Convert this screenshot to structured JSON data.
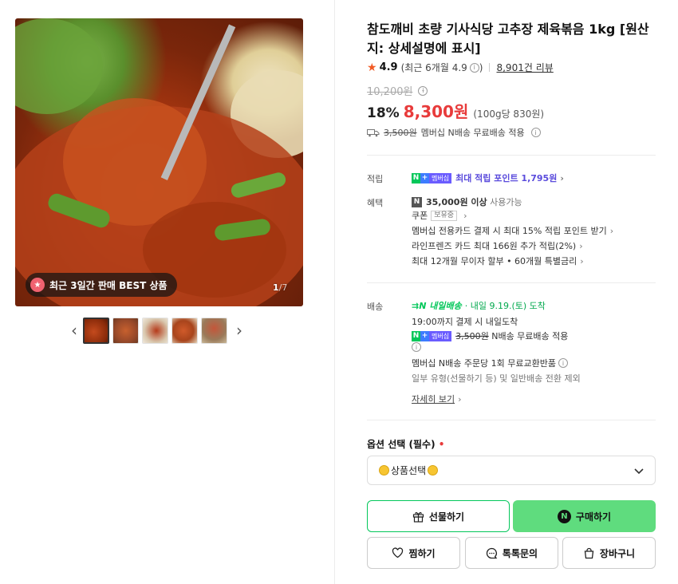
{
  "gallery": {
    "badge_text": "최근 3일간 판매 BEST 상품",
    "counter_current": "1",
    "counter_total": "/7",
    "thumbnail_count": 5
  },
  "product": {
    "title": "참도깨비 초량 기사식당 고추장 제육볶음 1kg [원산지: 상세설명에 표시]",
    "rating": "4.9",
    "rating_recent": "(최근 6개월 4.9",
    "rating_recent_close": ")",
    "review_count": "8,901건 리뷰",
    "original_price": "10,200원",
    "discount": "18%",
    "price": "8,300원",
    "unit_price": "(100g당 830원)",
    "shipping_original": "3,500원",
    "shipping_text": "멤버십 N배송 무료배송 적용"
  },
  "benefits": {
    "points_label": "적립",
    "points_text": "최대 적립 포인트 1,795원",
    "perks_label": "혜택",
    "coupon_amount": "35,000원 이상",
    "coupon_usable": "사용가능",
    "coupon_label": "쿠폰",
    "coupon_tag": "보유중",
    "card_line": "멤버십 전용카드 결제 시 최대 15% 적립 포인트 받기",
    "lineFriends_line": "라인프렌즈 카드 최대 166원 추가 적립(2%)",
    "installment_line": "최대 12개월 무이자 할부 • 60개월 특별금리"
  },
  "delivery": {
    "label": "배송",
    "tomorrow_tag": "내일배송",
    "arrival": "· 내일 9.19.(토) 도착",
    "cutoff": "19:00까지 결제 시 내일도착",
    "fee_original": "3,500원",
    "fee_text": "N배송 무료배송 적용",
    "exchange": "멤버십 N배송 주문당 1회 무료교환반품",
    "exclude": "일부 유형(선물하기 등) 및 일반배송 전환 제외",
    "more": "자세히 보기"
  },
  "options": {
    "label": "옵션 선택 (필수)",
    "required_mark": "•",
    "selected": "상품선택"
  },
  "buttons": {
    "gift": "선물하기",
    "buy": "구매하기",
    "zzim": "찜하기",
    "talk": "톡톡문의",
    "cart": "장바구니"
  },
  "colors": {
    "price_red": "#e83b3b",
    "naver_green": "#03c75a",
    "buy_button": "#5fdc7e",
    "points_purple": "#5a4bdc"
  }
}
